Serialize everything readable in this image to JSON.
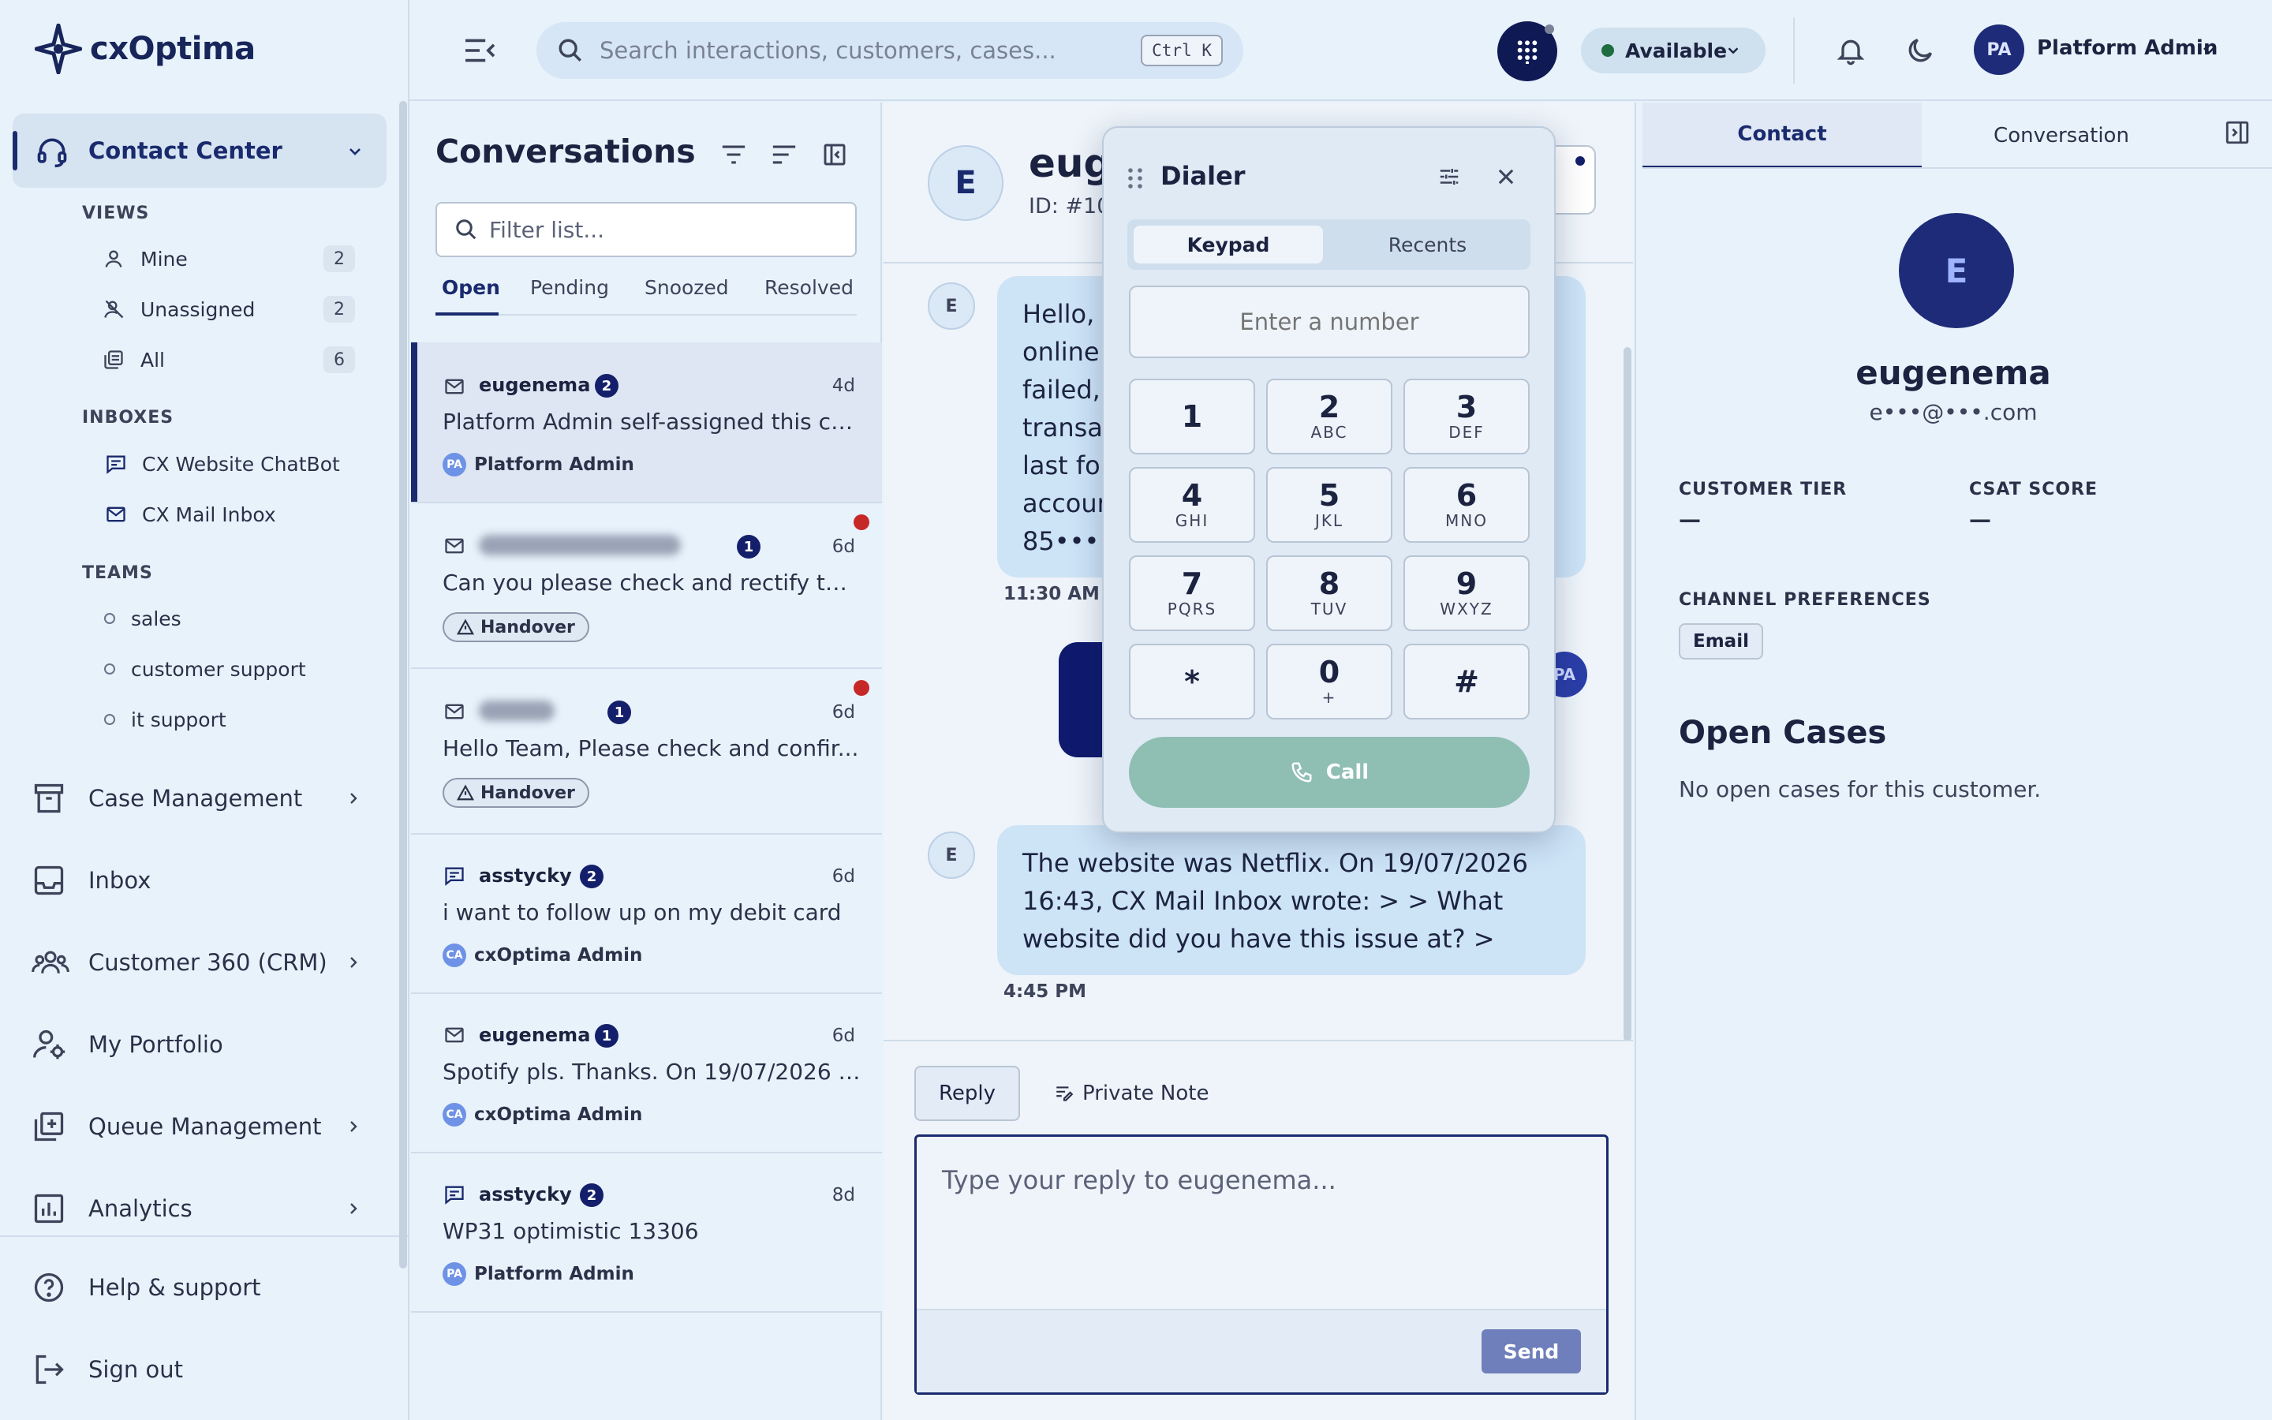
{
  "app": {
    "name": "cxOptima"
  },
  "sidebar": {
    "section_title": "Contact Center",
    "views_label": "VIEWS",
    "views": [
      {
        "label": "Mine",
        "count": "2"
      },
      {
        "label": "Unassigned",
        "count": "2"
      },
      {
        "label": "All",
        "count": "6"
      }
    ],
    "inboxes_label": "INBOXES",
    "inboxes": [
      {
        "label": "CX Website ChatBot"
      },
      {
        "label": "CX Mail Inbox"
      }
    ],
    "teams_label": "TEAMS",
    "teams": [
      {
        "label": "sales"
      },
      {
        "label": "customer support"
      },
      {
        "label": "it support"
      }
    ],
    "nav": [
      {
        "label": "Case Management",
        "icon": "archive-icon"
      },
      {
        "label": "Inbox",
        "icon": "inbox-icon"
      },
      {
        "label": "Customer 360 (CRM)",
        "icon": "users-icon"
      },
      {
        "label": "My Portfolio",
        "icon": "user-gear-icon"
      },
      {
        "label": "Queue Management",
        "icon": "queue-icon"
      },
      {
        "label": "Analytics",
        "icon": "chart-icon"
      }
    ],
    "footer": [
      {
        "label": "Help & support",
        "icon": "help-icon"
      },
      {
        "label": "Sign out",
        "icon": "sign-out-icon"
      }
    ]
  },
  "topbar": {
    "search_placeholder": "Search interactions, customers, cases...",
    "shortcut": "Ctrl K",
    "status": "Available",
    "user_initials": "PA",
    "user_name": "Platform Admin"
  },
  "conversations": {
    "title": "Conversations",
    "filter_placeholder": "Filter list...",
    "tabs": [
      "Open",
      "Pending",
      "Snoozed",
      "Resolved"
    ],
    "active_tab": "Open",
    "items": [
      {
        "name": "eugenema",
        "badge": "2",
        "time": "4d",
        "preview": "Platform Admin self-assigned this co...",
        "assignee_initials": "PA",
        "assignee": "Platform Admin",
        "channel": "mail"
      },
      {
        "name": "",
        "badge": "1",
        "time": "6d",
        "preview": "Can you please check and rectify the...",
        "tag": "Handover",
        "unread": true,
        "channel": "mail"
      },
      {
        "name": "",
        "badge": "1",
        "time": "6d",
        "preview": "Hello Team, Please check and confir...",
        "tag": "Handover",
        "unread": true,
        "channel": "mail"
      },
      {
        "name": "asstycky",
        "badge": "2",
        "time": "6d",
        "preview": "i want to follow up on my debit card",
        "assignee_initials": "CA",
        "assignee": "cxOptima Admin",
        "channel": "chat"
      },
      {
        "name": "eugenema",
        "badge": "1",
        "time": "6d",
        "preview": "Spotify pls. Thanks. On 19/07/2026 11...",
        "assignee_initials": "CA",
        "assignee": "cxOptima Admin",
        "channel": "mail"
      },
      {
        "name": "asstycky",
        "badge": "2",
        "time": "8d",
        "preview": "WP31 optimistic 13306",
        "assignee_initials": "PA",
        "assignee": "Platform Admin",
        "channel": "chat"
      }
    ]
  },
  "chat": {
    "avatar": "E",
    "name": "eug",
    "id": "ID: #10",
    "messages": [
      {
        "avatar": "E",
        "lines": [
          "Hello, I",
          "online",
          "failed,",
          "transac",
          "last fou",
          "accour",
          "85••••"
        ],
        "time": "11:30 AM"
      },
      {
        "avatar": "E",
        "lines": [
          "The website was Netflix. On 19/07/2026",
          "16:43, CX Mail Inbox wrote: > > What",
          "website did you have this issue at? >"
        ],
        "time": "4:45 PM"
      }
    ],
    "outgoing_avatar": "PA",
    "reply_tab": "Reply",
    "note_tab": "Private Note",
    "reply_placeholder": "Type your reply to eugenema...",
    "send_label": "Send"
  },
  "dialer": {
    "title": "Dialer",
    "tabs": [
      "Keypad",
      "Recents"
    ],
    "number_placeholder": "Enter a number",
    "keys": [
      {
        "n": "1",
        "s": ""
      },
      {
        "n": "2",
        "s": "ABC"
      },
      {
        "n": "3",
        "s": "DEF"
      },
      {
        "n": "4",
        "s": "GHI"
      },
      {
        "n": "5",
        "s": "JKL"
      },
      {
        "n": "6",
        "s": "MNO"
      },
      {
        "n": "7",
        "s": "PQRS"
      },
      {
        "n": "8",
        "s": "TUV"
      },
      {
        "n": "9",
        "s": "WXYZ"
      },
      {
        "n": "*",
        "s": ""
      },
      {
        "n": "0",
        "s": "+"
      },
      {
        "n": "#",
        "s": ""
      }
    ],
    "call_label": "Call"
  },
  "contact": {
    "tabs": [
      "Contact",
      "Conversation"
    ],
    "active_tab": "Contact",
    "avatar": "E",
    "name": "eugenema",
    "email": "e•••@•••.com",
    "tier_label": "CUSTOMER TIER",
    "tier_value": "—",
    "csat_label": "CSAT SCORE",
    "csat_value": "—",
    "channel_label": "CHANNEL PREFERENCES",
    "channel_value": "Email",
    "cases_title": "Open Cases",
    "cases_empty": "No open cases for this customer."
  },
  "colors": {
    "accent": "#1a2a6e",
    "background": "#e8f2fb",
    "bubble": "#cde3f6",
    "unread": "#c62828",
    "call": "#8fbeb3"
  }
}
